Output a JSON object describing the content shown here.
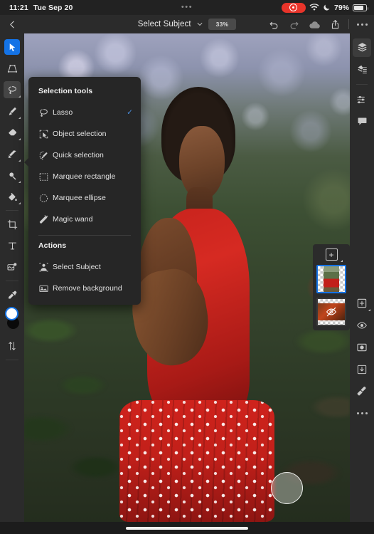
{
  "status_bar": {
    "time": "11:21",
    "date": "Tue Sep 20",
    "center_dots": "•••",
    "recording_icon": "record-dot-icon",
    "wifi_icon": "wifi-icon",
    "moon_icon": "moon-icon",
    "battery_percent": "79%",
    "battery_icon": "battery-icon",
    "accent_red": "#e8342a"
  },
  "toolbar": {
    "back_icon": "chevron-left-icon",
    "title": "Select Subject",
    "title_chevron": "chevron-down-icon",
    "zoom_level": "33%",
    "undo_icon": "undo-icon",
    "redo_icon": "redo-icon",
    "cloud_icon": "cloud-icon",
    "share_icon": "share-icon",
    "more_icon": "more-horizontal-icon"
  },
  "menu": {
    "section_tools_title": "Selection tools",
    "section_actions_title": "Actions",
    "tools": [
      {
        "label": "Lasso",
        "icon": "lasso-icon",
        "checked": "✓"
      },
      {
        "label": "Object selection",
        "icon": "object-selection-icon",
        "checked": ""
      },
      {
        "label": "Quick selection",
        "icon": "quick-selection-icon",
        "checked": ""
      },
      {
        "label": "Marquee rectangle",
        "icon": "marquee-rectangle-icon",
        "checked": ""
      },
      {
        "label": "Marquee ellipse",
        "icon": "marquee-ellipse-icon",
        "checked": ""
      },
      {
        "label": "Magic wand",
        "icon": "magic-wand-icon",
        "checked": ""
      }
    ],
    "actions": [
      {
        "label": "Select Subject",
        "icon": "select-subject-icon"
      },
      {
        "label": "Remove background",
        "icon": "remove-background-icon"
      }
    ],
    "check_color": "#4a8fe0"
  },
  "left_toolbar": {
    "items": [
      {
        "name": "move-tool",
        "icon": "arrow-cursor-icon",
        "state": "active-blue"
      },
      {
        "name": "transform-tool",
        "icon": "transform-icon",
        "state": ""
      },
      {
        "name": "lasso-tool",
        "icon": "lasso-icon",
        "state": "active-grey"
      },
      {
        "name": "brush-tool",
        "icon": "brush-icon",
        "state": ""
      },
      {
        "name": "eraser-tool",
        "icon": "eraser-icon",
        "state": ""
      },
      {
        "name": "clone-stamp-tool",
        "icon": "clone-stamp-icon",
        "state": ""
      },
      {
        "name": "blur-tool",
        "icon": "blur-icon",
        "state": ""
      },
      {
        "name": "paint-bucket-tool",
        "icon": "paint-bucket-icon",
        "state": ""
      },
      {
        "name": "crop-tool",
        "icon": "crop-icon",
        "state": ""
      },
      {
        "name": "text-tool",
        "icon": "text-t-icon",
        "state": ""
      },
      {
        "name": "place-photo-tool",
        "icon": "place-photo-icon",
        "state": ""
      },
      {
        "name": "eyedropper-tool",
        "icon": "eyedropper-icon",
        "state": ""
      }
    ],
    "foreground_color": "#ffffff",
    "background_color": "#0a0a0a",
    "swap_icon": "swap-arrows-icon",
    "active_color": "#1473e6"
  },
  "right_toolbar": {
    "items": [
      {
        "name": "layers-panel-button",
        "icon": "layers-icon",
        "state": "sel"
      },
      {
        "name": "layer-properties-button",
        "icon": "layer-properties-icon",
        "state": ""
      },
      {
        "name": "adjustments-button",
        "icon": "sliders-icon",
        "state": ""
      },
      {
        "name": "comments-button",
        "icon": "comment-bubble-icon",
        "state": ""
      },
      {
        "name": "add-layer-button",
        "icon": "add-square-icon",
        "state": ""
      },
      {
        "name": "visibility-button",
        "icon": "eye-icon",
        "state": ""
      },
      {
        "name": "mask-button",
        "icon": "mask-icon",
        "state": ""
      },
      {
        "name": "clipping-mask-button",
        "icon": "clipping-mask-icon",
        "state": ""
      },
      {
        "name": "blend-mode-button",
        "icon": "blend-icon",
        "state": ""
      },
      {
        "name": "layer-more-button",
        "icon": "more-horizontal-icon",
        "state": ""
      }
    ]
  },
  "layers_panel": {
    "add_label": "+",
    "layers": [
      {
        "name": "layer-thumbnail-selected",
        "selected": true,
        "hidden": false
      },
      {
        "name": "layer-thumbnail-hidden",
        "selected": false,
        "hidden": true
      }
    ],
    "selection_color": "#1473e6"
  },
  "canvas": {
    "brush_cursor": "brush-cursor-circle"
  }
}
